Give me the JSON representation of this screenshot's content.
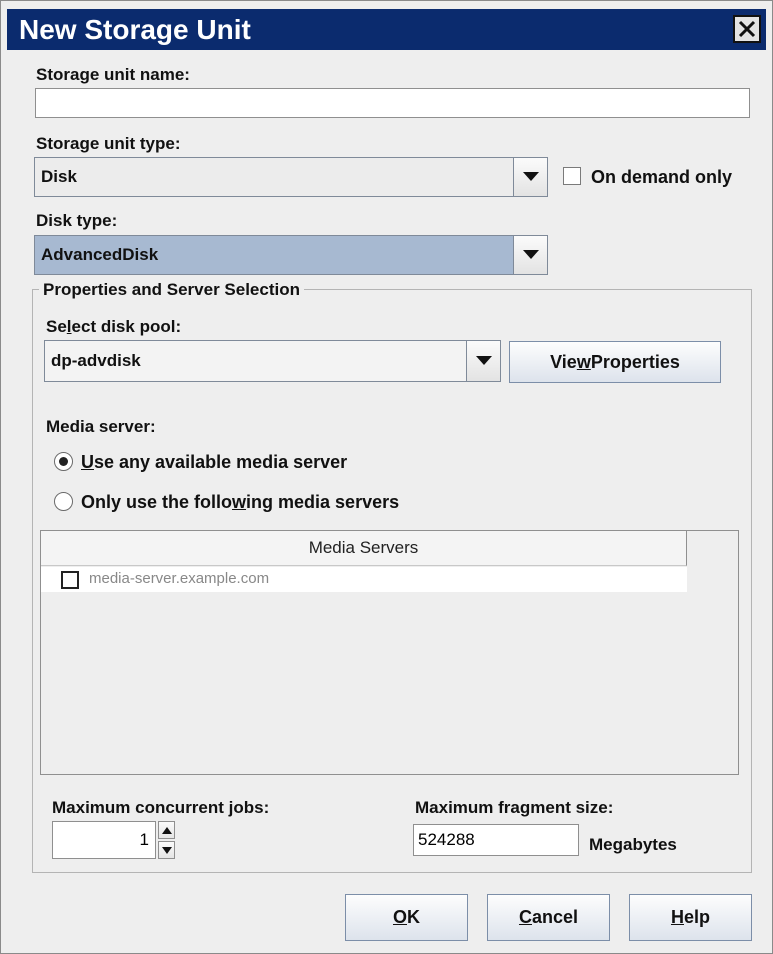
{
  "window": {
    "title": "New Storage Unit",
    "close_icon": "close-icon"
  },
  "storage_unit_name": {
    "label": "Storage unit name:",
    "value": ""
  },
  "storage_unit_type": {
    "label": "Storage unit type:",
    "selected": "Disk"
  },
  "on_demand_only": {
    "label": "On demand only",
    "checked": false
  },
  "disk_type": {
    "label": "Disk type:",
    "selected": "AdvancedDisk"
  },
  "properties_group": {
    "title": "Properties and Server Selection",
    "disk_pool": {
      "label_pre": "Se",
      "label_mnemonic": "l",
      "label_post": "ect disk pool:",
      "selected": "dp-advdisk"
    },
    "view_properties": {
      "label_pre": "Vie",
      "label_mnemonic": "w",
      "label_post": " Properties"
    },
    "media_server": {
      "label": "Media server:",
      "option_any": {
        "label_mnemonic": "U",
        "label_post": "se any available media server",
        "checked": true
      },
      "option_only": {
        "label_pre": "Only use the follo",
        "label_mnemonic": "w",
        "label_post": "ing media servers",
        "checked": false
      }
    },
    "media_servers_table": {
      "header": "Media Servers",
      "rows": [
        {
          "name": "media-server.example.com",
          "checked": false
        }
      ]
    },
    "max_concurrent_jobs": {
      "label": "Maximum concurrent jobs:",
      "value": "1"
    },
    "max_fragment_size": {
      "label": "Maximum fragment size:",
      "value": "524288",
      "unit": "Megabytes"
    }
  },
  "buttons": {
    "ok": {
      "mnemonic": "O",
      "rest": "K"
    },
    "cancel": {
      "mnemonic": "C",
      "rest": "ancel"
    },
    "help": {
      "mnemonic": "H",
      "rest": "elp"
    }
  },
  "colors": {
    "titlebar": "#0b2b6e",
    "selected_combo": "#a7b9d1"
  }
}
